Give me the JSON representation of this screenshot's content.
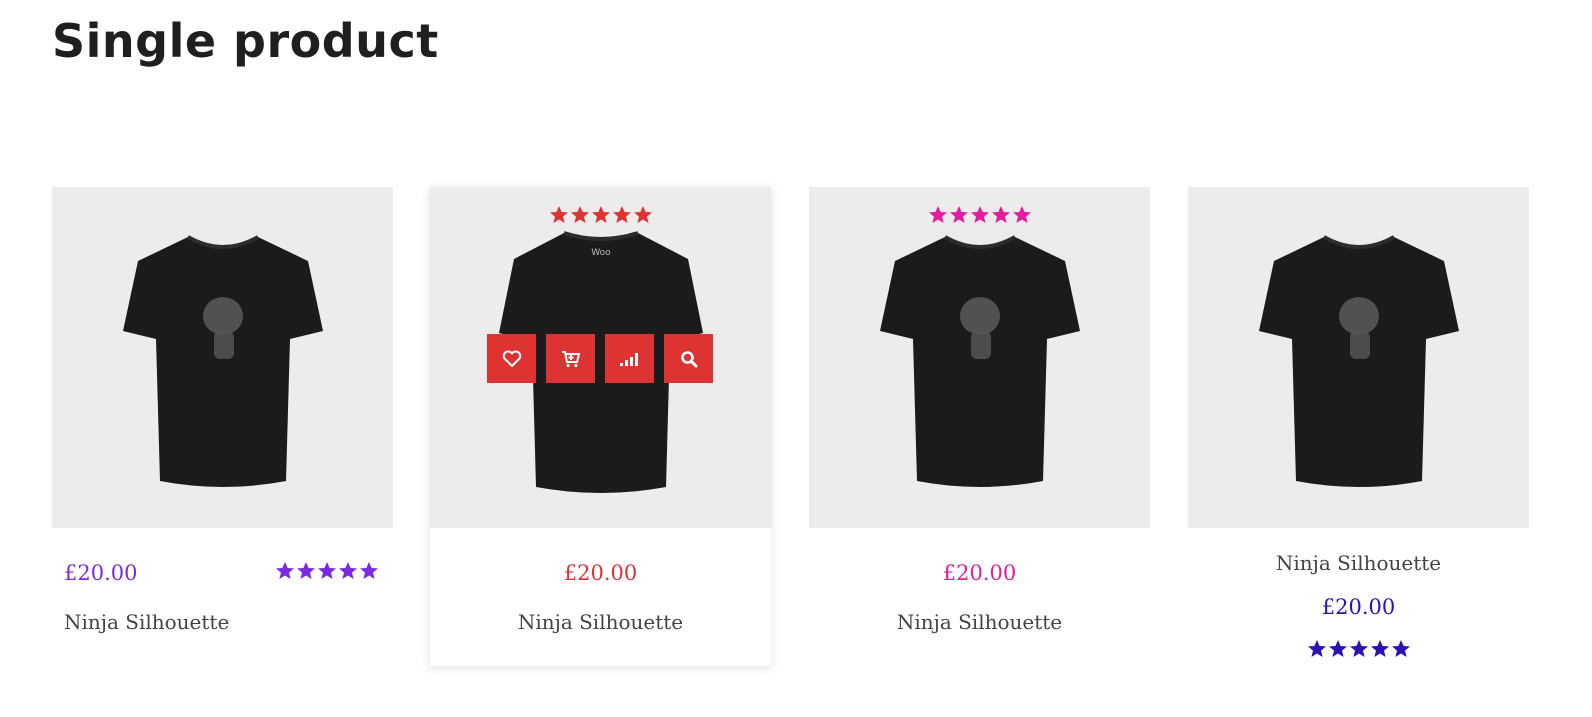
{
  "page": {
    "title": "Single product"
  },
  "colors": {
    "purple": "#7b2ae0",
    "red": "#dd3333",
    "pink": "#e21d9e",
    "navy": "#2a12b5",
    "thumb_bg": "#ececed",
    "shirt": "#1b1b1b"
  },
  "products": [
    {
      "price": "£20.00",
      "name": "Ninja Silhouette",
      "rating": 5,
      "accent": "purple"
    },
    {
      "price": "£20.00",
      "name": "Ninja Silhouette",
      "rating": 5,
      "accent": "red",
      "shirt_label": "Woo",
      "actions": [
        {
          "icon": "heart-icon",
          "label": "Add to wishlist"
        },
        {
          "icon": "cart-plus-icon",
          "label": "Add to cart"
        },
        {
          "icon": "compare-signal-icon",
          "label": "Compare"
        },
        {
          "icon": "search-icon",
          "label": "Quick view"
        }
      ]
    },
    {
      "price": "£20.00",
      "name": "Ninja Silhouette",
      "rating": 5,
      "accent": "pink"
    },
    {
      "price": "£20.00",
      "name": "Ninja Silhouette",
      "rating": 5,
      "accent": "navy"
    }
  ]
}
